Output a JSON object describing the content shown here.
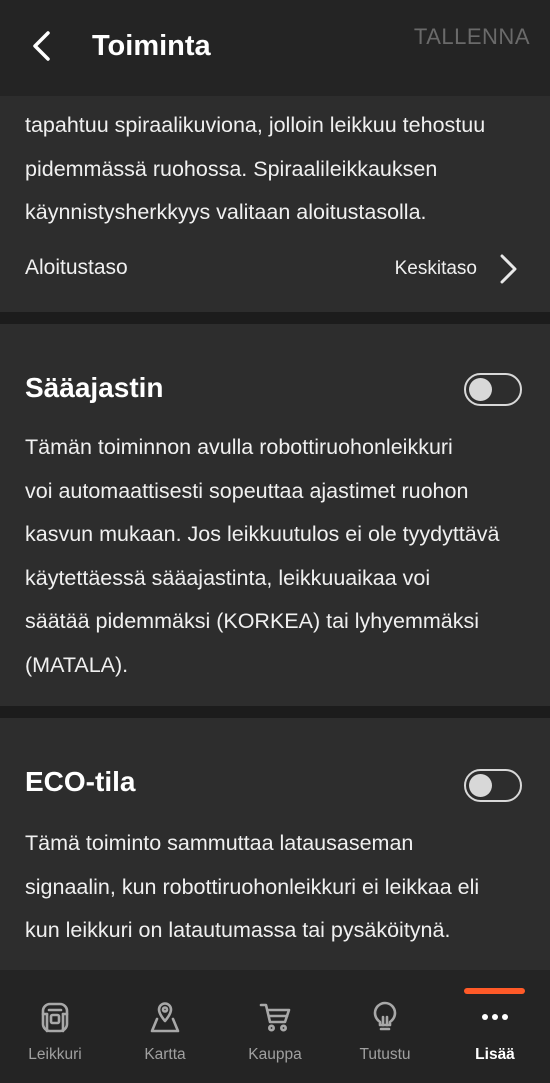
{
  "header": {
    "title": "Toiminta",
    "save_label": "TALLENNA",
    "back_icon": "chevron-left-icon"
  },
  "spiral_section": {
    "text_lines": [
      "tapahtuu spiraalikuviona, jolloin leikkuu tehostuu",
      "pidemmässä ruohossa. Spiraalileikkauksen",
      "käynnistysherkkyys valitaan aloitustasolla."
    ],
    "setting_label": "Aloitustaso",
    "setting_value": "Keskitaso"
  },
  "weather_timer": {
    "title": "Sääajastin",
    "enabled": false,
    "text_lines": [
      "Tämän toiminnon avulla robottiruohonleikkuri",
      "voi automaattisesti sopeuttaa ajastimet ruohon",
      "kasvun mukaan. Jos leikkuutulos ei ole tyydyttävä",
      "käytettäessä sääajastinta, leikkuuaikaa voi",
      "säätää pidemmäksi (KORKEA) tai lyhyemmäksi",
      "(MATALA)."
    ]
  },
  "eco_mode": {
    "title": "ECO-tila",
    "enabled": false,
    "text_lines": [
      "Tämä toiminto sammuttaa latausaseman",
      "signaalin, kun robottiruohonleikkuri ei leikkaa eli",
      "kun leikkuri on latautumassa tai pysäköitynä."
    ]
  },
  "tabbar": {
    "active_color": "#ff5a28",
    "tabs": [
      {
        "label": "Leikkuri",
        "icon": "mower-icon",
        "active": false
      },
      {
        "label": "Kartta",
        "icon": "map-pin-icon",
        "active": false
      },
      {
        "label": "Kauppa",
        "icon": "cart-icon",
        "active": false
      },
      {
        "label": "Tutustu",
        "icon": "lightbulb-icon",
        "active": false
      },
      {
        "label": "Lisää",
        "icon": "more-dots-icon",
        "active": true
      }
    ]
  }
}
